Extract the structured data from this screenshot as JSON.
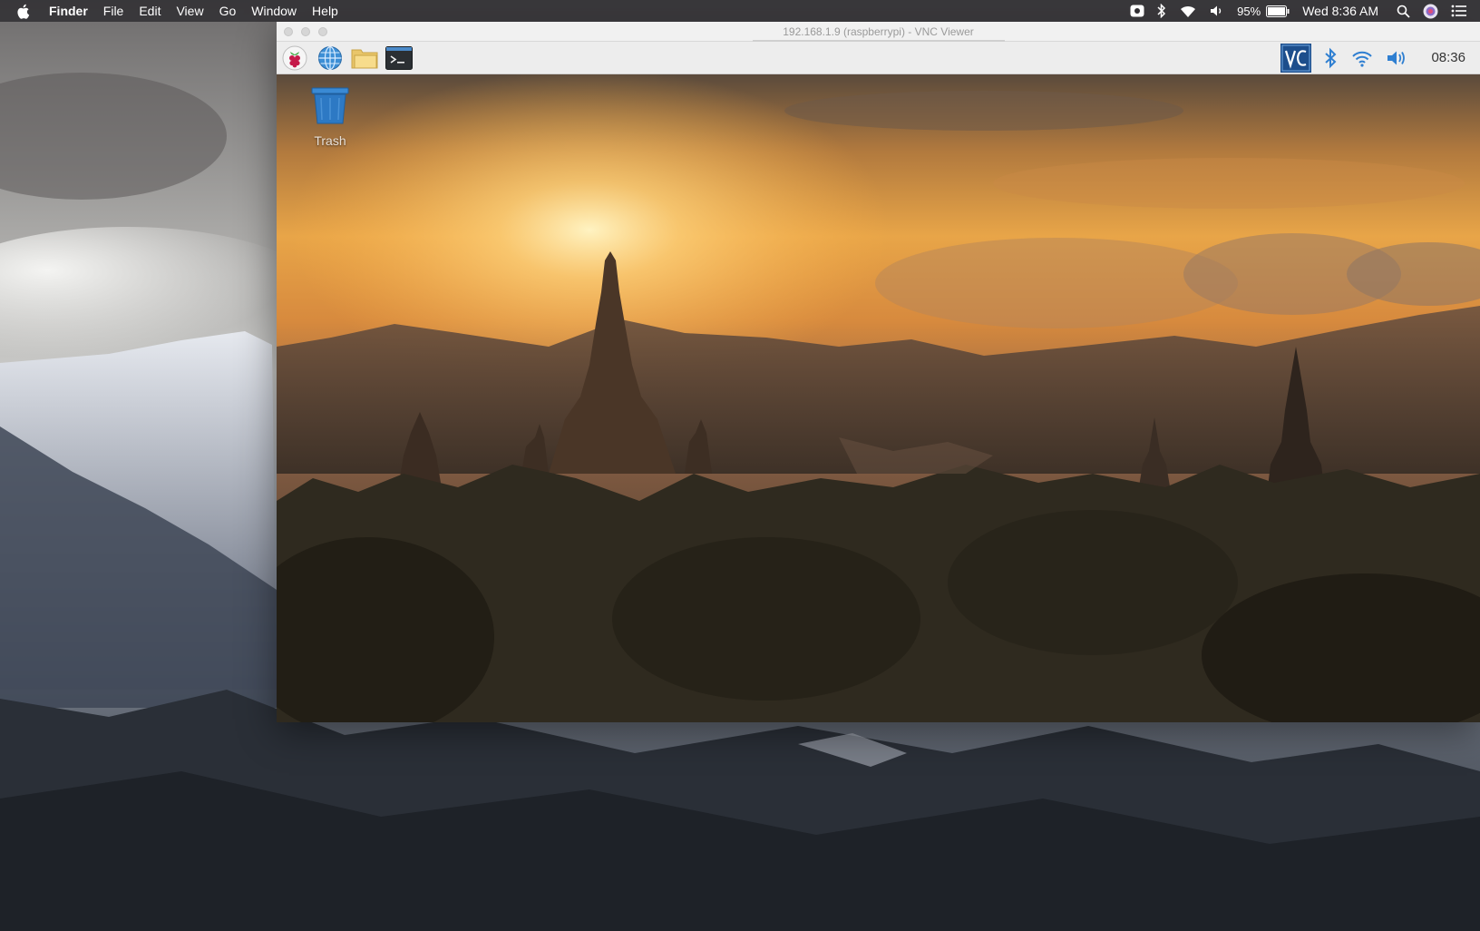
{
  "menubar": {
    "app": "Finder",
    "menus": [
      "File",
      "Edit",
      "View",
      "Go",
      "Window",
      "Help"
    ],
    "battery": "95%",
    "clock": "Wed 8:36 AM",
    "status_icons": [
      "screen-record-icon",
      "bluetooth-icon",
      "wifi-icon",
      "volume-icon",
      "battery-icon",
      "spotlight-search-icon",
      "siri-icon",
      "notification-center-icon"
    ]
  },
  "vnc_window": {
    "title": "192.168.1.9 (raspberrypi) - VNC Viewer"
  },
  "pi_panel": {
    "launchers": [
      "raspberry-menu-icon",
      "web-browser-icon",
      "file-manager-icon",
      "terminal-icon"
    ],
    "tray_icons": [
      "vnc-server-icon",
      "bluetooth-icon",
      "wifi-icon",
      "volume-icon"
    ],
    "clock": "08:36"
  },
  "pi_desktop": {
    "trash_label": "Trash"
  },
  "colors": {
    "menubar_bg": "#302e32",
    "panel_bg": "#ededed",
    "vnc_tray_blue": "#1d4e8c",
    "trash_blue": "#2d79c4"
  }
}
